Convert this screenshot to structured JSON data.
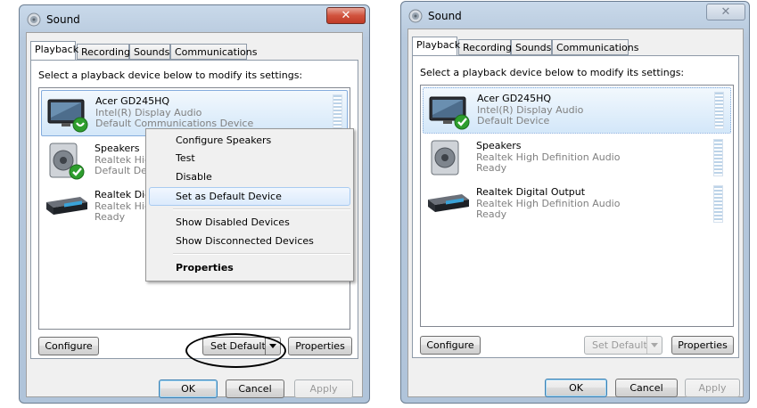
{
  "left": {
    "title": "Sound",
    "tabs": [
      "Playback",
      "Recording",
      "Sounds",
      "Communications"
    ],
    "instruction": "Select a playback device below to modify its settings:",
    "devices": [
      {
        "name": "Acer GD245HQ",
        "line2": "Intel(R) Display Audio",
        "line3": "Default Communications Device",
        "status_icon": "phone-badge-icon"
      },
      {
        "name": "Speakers",
        "line2": "Realtek High Definition Audio",
        "line3": "Default Device",
        "status_icon": "green-check-icon"
      },
      {
        "name": "Realtek Digital Output",
        "line2": "Realtek High Definition Audio",
        "line3": "Ready",
        "status_icon": ""
      }
    ],
    "context_menu": [
      {
        "label": "Configure Speakers"
      },
      {
        "label": "Test"
      },
      {
        "label": "Disable"
      },
      {
        "label": "Set as Default Device"
      },
      {
        "label": "Show Disabled Devices"
      },
      {
        "label": "Show Disconnected Devices"
      },
      {
        "label": "Properties"
      }
    ],
    "buttons": {
      "configure": "Configure",
      "set_default": "Set Default",
      "properties": "Properties",
      "ok": "OK",
      "cancel": "Cancel",
      "apply": "Apply"
    }
  },
  "right": {
    "title": "Sound",
    "tabs": [
      "Playback",
      "Recording",
      "Sounds",
      "Communications"
    ],
    "instruction": "Select a playback device below to modify its settings:",
    "devices": [
      {
        "name": "Acer GD245HQ",
        "line2": "Intel(R) Display Audio",
        "line3": "Default Device",
        "status_icon": "green-check-icon"
      },
      {
        "name": "Speakers",
        "line2": "Realtek High Definition Audio",
        "line3": "Ready",
        "status_icon": ""
      },
      {
        "name": "Realtek Digital Output",
        "line2": "Realtek High Definition Audio",
        "line3": "Ready",
        "status_icon": ""
      }
    ],
    "buttons": {
      "configure": "Configure",
      "set_default": "Set Default",
      "properties": "Properties",
      "ok": "OK",
      "cancel": "Cancel",
      "apply": "Apply"
    }
  },
  "colors": {
    "selection": "#d3e7f9",
    "window_frame": "#b7c9dd",
    "close_button": "#c03b27",
    "check_green": "#2e9e2e"
  }
}
